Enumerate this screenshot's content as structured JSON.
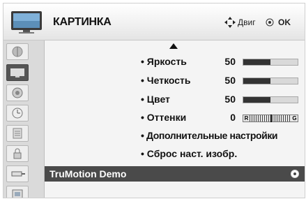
{
  "header": {
    "title": "КАРТИНКА",
    "move_hint": "Двиг",
    "ok_hint": "OK",
    "icon": "tv-picture-icon"
  },
  "sidebar": {
    "items": [
      {
        "icon": "picture-wizard-icon",
        "active": false
      },
      {
        "icon": "picture-icon",
        "active": true
      },
      {
        "icon": "audio-icon",
        "active": false
      },
      {
        "icon": "time-icon",
        "active": false
      },
      {
        "icon": "option-icon",
        "active": false
      },
      {
        "icon": "lock-icon",
        "active": false
      },
      {
        "icon": "input-icon",
        "active": false
      },
      {
        "icon": "usb-icon",
        "active": false
      }
    ]
  },
  "settings": {
    "brightness": {
      "label": "• Яркость",
      "value": "50",
      "level": 0.5
    },
    "sharpness": {
      "label": "• Четкость",
      "value": "50",
      "level": 0.5
    },
    "color": {
      "label": "• Цвет",
      "value": "50",
      "level": 0.5
    },
    "tint": {
      "label": "• Оттенки",
      "value": "0",
      "left_end": "R",
      "right_end": "G",
      "level": 0.5
    },
    "advanced": {
      "label": "• Дополнительные настройки"
    },
    "reset": {
      "label": "• Сброс наст. изобр."
    },
    "truemotion": {
      "label": "TruMotion Demo"
    }
  },
  "colors": {
    "selected_bg": "#4a4a4a",
    "bar_fill": "#333333"
  }
}
